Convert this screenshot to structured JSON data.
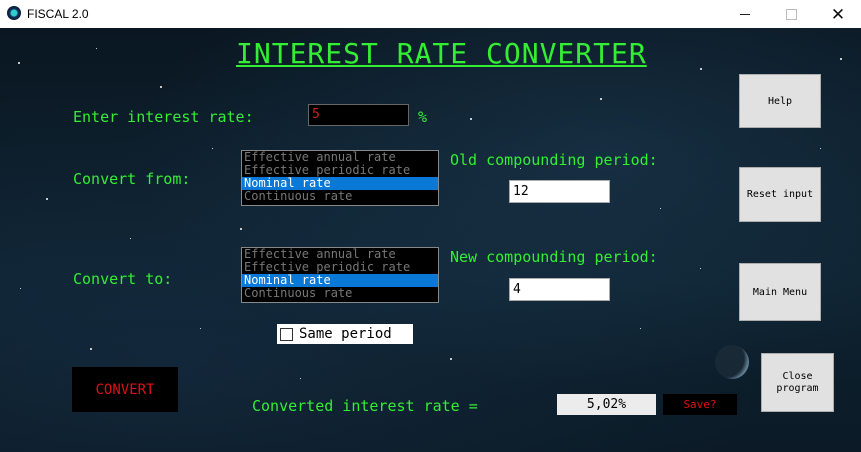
{
  "window": {
    "title": "FISCAL 2.0",
    "minimize_glyph": "",
    "close_glyph": "✕"
  },
  "page": {
    "title": "INTEREST RATE CONVERTER"
  },
  "rate_input": {
    "label": "Enter interest rate:",
    "value": "5",
    "unit": "%"
  },
  "convert_from": {
    "label": "Convert from:",
    "options": [
      "Effective annual rate",
      "Effective periodic rate",
      "Nominal rate",
      "Continuous rate"
    ],
    "selected_index": 2
  },
  "convert_to": {
    "label": "Convert to:",
    "options": [
      "Effective annual rate",
      "Effective periodic rate",
      "Nominal rate",
      "Continuous rate"
    ],
    "selected_index": 2
  },
  "old_period": {
    "label": "Old compounding period:",
    "value": "12"
  },
  "new_period": {
    "label": "New compounding period:",
    "value": "4"
  },
  "same_period": {
    "label": "Same period",
    "checked": false
  },
  "buttons": {
    "help": "Help",
    "reset": "Reset input",
    "main_menu": "Main Menu",
    "close_program": "Close program",
    "convert": "CONVERT",
    "save": "Save?"
  },
  "result": {
    "label": "Converted interest rate =",
    "value": "5,02%"
  },
  "colors": {
    "accent_green": "#33ee33",
    "alert_red": "#dd1111",
    "selection_blue": "#0a78d7"
  }
}
